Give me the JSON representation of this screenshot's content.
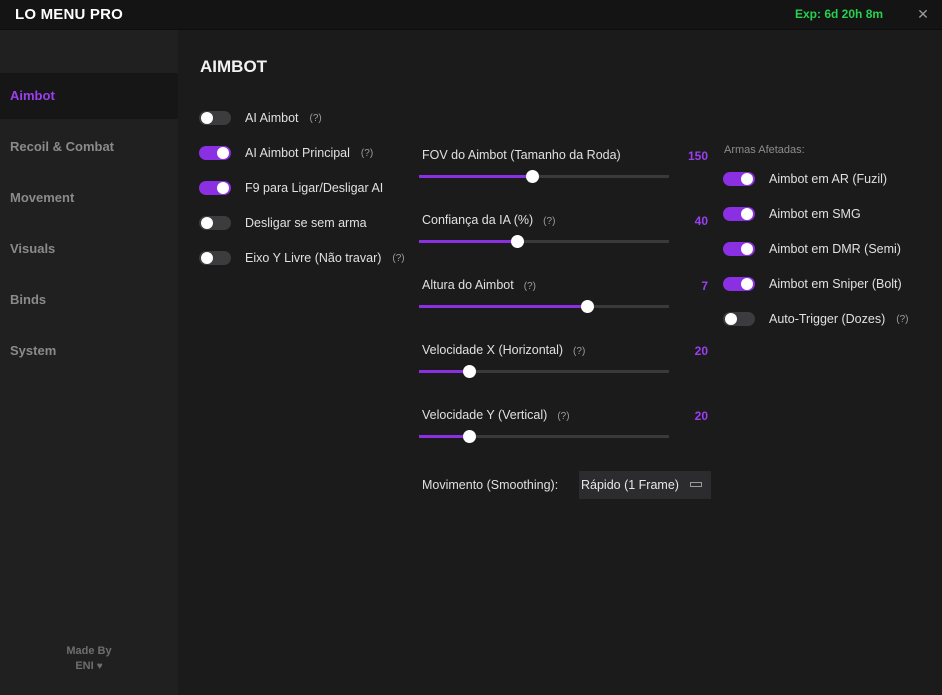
{
  "titlebar": {
    "title": "LO MENU PRO",
    "expiry": "Exp: 6d 20h 8m",
    "close_glyph": "✕"
  },
  "sidebar": {
    "items": [
      {
        "label": "Aimbot",
        "active": true
      },
      {
        "label": "Recoil & Combat",
        "active": false
      },
      {
        "label": "Movement",
        "active": false
      },
      {
        "label": "Visuals",
        "active": false
      },
      {
        "label": "Binds",
        "active": false
      },
      {
        "label": "System",
        "active": false
      }
    ],
    "credits_line1": "Made By",
    "credits_line2": "ENI",
    "heart_glyph": "♥"
  },
  "page": {
    "title": "AIMBOT"
  },
  "toggles": [
    {
      "label": "AI Aimbot",
      "on": false,
      "help": "(?)"
    },
    {
      "label": "AI Aimbot Principal",
      "on": true,
      "help": "(?)"
    },
    {
      "label": "F9 para Ligar/Desligar AI",
      "on": true,
      "help": ""
    },
    {
      "label": "Desligar se sem arma",
      "on": false,
      "help": ""
    },
    {
      "label": "Eixo Y Livre (Não travar)",
      "on": false,
      "help": "(?)"
    }
  ],
  "sliders": [
    {
      "label": "FOV do Aimbot (Tamanho da Roda)",
      "value": "150",
      "fraction": 0.45,
      "help": ""
    },
    {
      "label": "Confiança da IA (%)",
      "value": "40",
      "fraction": 0.39,
      "help": "(?)"
    },
    {
      "label": "Altura do Aimbot",
      "value": "7",
      "fraction": 0.67,
      "help": "(?)"
    },
    {
      "label": "Velocidade X (Horizontal)",
      "value": "20",
      "fraction": 0.2,
      "help": "(?)"
    },
    {
      "label": "Velocidade Y (Vertical)",
      "value": "20",
      "fraction": 0.2,
      "help": "(?)"
    }
  ],
  "smoothing": {
    "label": "Movimento (Smoothing):",
    "selected": "Rápido (1 Frame)"
  },
  "weapons": {
    "heading": "Armas Afetadas:",
    "items": [
      {
        "label": "Aimbot em AR (Fuzil)",
        "on": true,
        "help": ""
      },
      {
        "label": "Aimbot em SMG",
        "on": true,
        "help": ""
      },
      {
        "label": "Aimbot em DMR (Semi)",
        "on": true,
        "help": ""
      },
      {
        "label": "Aimbot em Sniper (Bolt)",
        "on": true,
        "help": ""
      },
      {
        "label": "Auto-Trigger (Dozes)",
        "on": false,
        "help": "(?)"
      }
    ]
  },
  "colors": {
    "accent": "#8b2fe3",
    "accent_text": "#9b3ff0",
    "expiry_green": "#27d04f",
    "background": "#1b1b1c",
    "sidebar": "#202021"
  }
}
